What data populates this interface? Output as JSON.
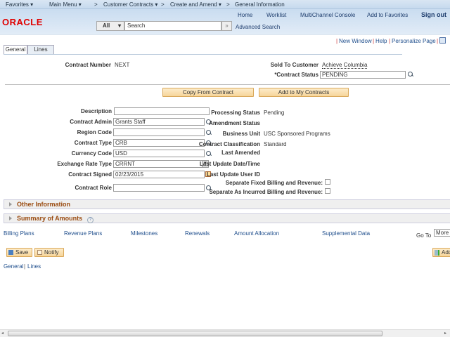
{
  "breadcrumb": {
    "favorites": "Favorites ▾",
    "main_menu": "Main Menu ▾",
    "sep": ">",
    "customer_contracts": "Customer Contracts ▾",
    "create_amend": "Create and Amend ▾",
    "current": "General Information"
  },
  "header": {
    "logo": "ORACLE",
    "links": [
      "Home",
      "Worklist",
      "MultiChannel Console",
      "Add to Favorites"
    ],
    "sign_out": "Sign out",
    "search_scope": "All",
    "search_placeholder": "Search",
    "search_go": "»",
    "advanced_search": "Advanced Search"
  },
  "pagebar": {
    "new_window": "New Window",
    "help": "Help",
    "personalize": "Personalize Page"
  },
  "tabs": [
    "General",
    "Lines"
  ],
  "fields": {
    "contract_number_label": "Contract Number",
    "contract_number": "NEXT",
    "sold_to_label": "Sold To Customer",
    "sold_to": "Achieve Columbia",
    "status_label": "*Contract Status",
    "status": "PENDING",
    "copy_btn": "Copy From Contract",
    "add_my_btn": "Add to My Contracts",
    "left": [
      {
        "label": "Description",
        "value": ""
      },
      {
        "label": "Contract Admin",
        "value": "Grants Staff"
      },
      {
        "label": "Region Code",
        "value": ""
      },
      {
        "label": "Contract Type",
        "value": "CRB"
      },
      {
        "label": "Currency Code",
        "value": "USD"
      },
      {
        "label": "Exchange Rate Type",
        "value": "CRRNT"
      },
      {
        "label": "Contract Signed",
        "value": "02/23/2015"
      },
      {
        "label": "Contract Role",
        "value": ""
      }
    ],
    "right": [
      {
        "label": "Processing Status",
        "value": "Pending"
      },
      {
        "label": "Amendment Status",
        "value": ""
      },
      {
        "label": "Business Unit",
        "value": "USC Sponsored Programs"
      },
      {
        "label": "Contract Classification",
        "value": "Standard"
      },
      {
        "label": "Last Amended",
        "value": ""
      },
      {
        "label": "Last Update Date/Time",
        "value": ""
      },
      {
        "label": "Last Update User ID",
        "value": ""
      }
    ],
    "sep_fixed": "Separate Fixed Billing and Revenue:",
    "sep_incurred": "Separate As Incurred Billing and Revenue:"
  },
  "sections": {
    "other": "Other Information",
    "summary": "Summary of Amounts",
    "help": "?"
  },
  "links": [
    "Billing Plans",
    "Revenue Plans",
    "Milestones",
    "Renewals",
    "Amount Allocation",
    "Supplemental Data"
  ],
  "goto": {
    "label": "Go To",
    "value": "More"
  },
  "actions": {
    "save": "Save",
    "notify": "Notify",
    "add": "Add"
  },
  "footer": {
    "general": "General",
    "sep": "|",
    "lines": "Lines"
  },
  "colors": {
    "accent": "#9a4b10",
    "link": "#1f4e8c",
    "logo": "#e00000"
  }
}
